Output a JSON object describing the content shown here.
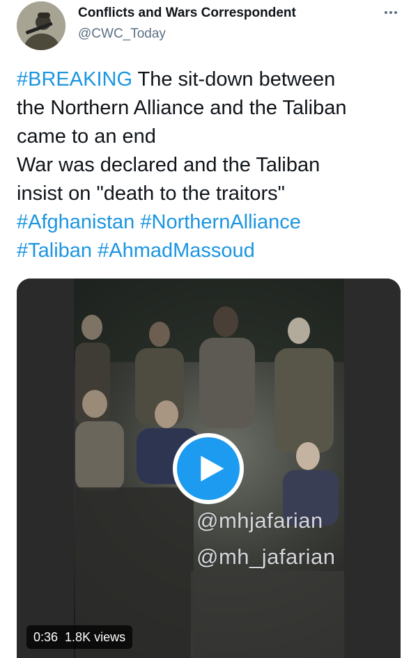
{
  "author": {
    "display_name": "Conflicts and Wars Correspondent",
    "handle": "@CWC_Today"
  },
  "tweet": {
    "lines": [
      [
        {
          "text": "#BREAKING",
          "tag": true
        },
        {
          "text": " The sit-down between",
          "tag": false
        }
      ],
      [
        {
          "text": "the Northern Alliance and the Taliban",
          "tag": false
        }
      ],
      [
        {
          "text": "came to an end",
          "tag": false
        }
      ],
      [
        {
          "text": "War was declared and the Taliban",
          "tag": false
        }
      ],
      [
        {
          "text": "insist on \"death to the traitors\"",
          "tag": false
        }
      ],
      [
        {
          "text": "#Afghanistan",
          "tag": true
        },
        {
          "text": " ",
          "tag": false
        },
        {
          "text": "#NorthernAlliance",
          "tag": true
        }
      ],
      [
        {
          "text": "#Taliban",
          "tag": true
        },
        {
          "text": " ",
          "tag": false
        },
        {
          "text": "#AhmadMassoud",
          "tag": true
        }
      ]
    ]
  },
  "media": {
    "watermark_1": "@mhjafarian",
    "watermark_2": "@mh_jafarian",
    "duration": "0:36",
    "views": "1.8K views"
  },
  "colors": {
    "hashtag": "#1b95e0",
    "play_button": "#1d9bf0",
    "secondary_text": "#5b7083"
  },
  "icons": {
    "more": "more-dots-icon",
    "play": "play-icon"
  }
}
